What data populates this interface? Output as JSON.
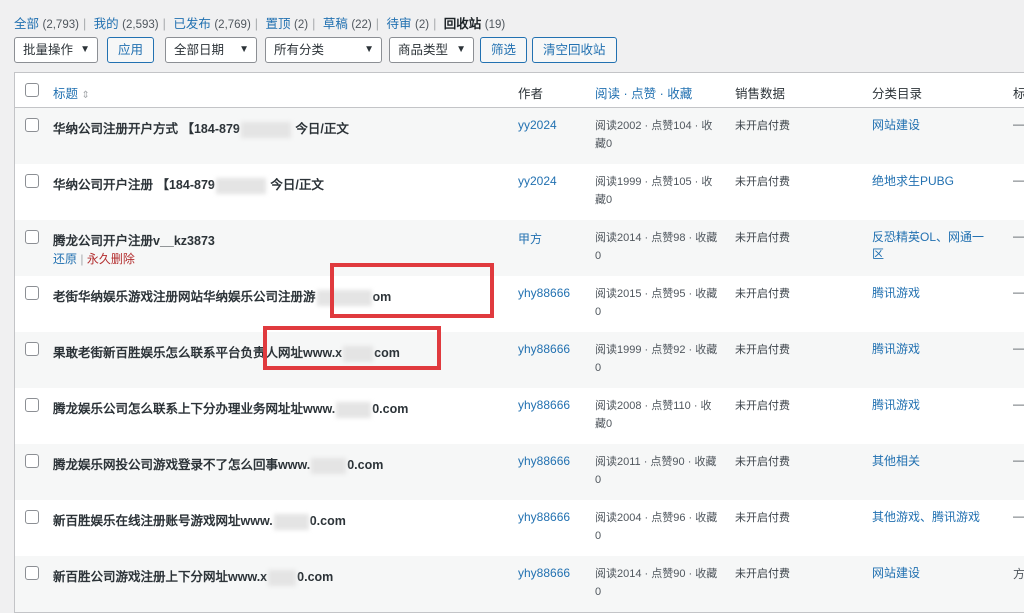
{
  "filters": [
    {
      "label": "全部",
      "count": "(2,793)",
      "current": false
    },
    {
      "label": "我的",
      "count": "(2,593)",
      "current": false
    },
    {
      "label": "已发布",
      "count": "(2,769)",
      "current": false
    },
    {
      "label": "置顶",
      "count": "(2)",
      "current": false
    },
    {
      "label": "草稿",
      "count": "(22)",
      "current": false
    },
    {
      "label": "待审",
      "count": "(2)",
      "current": false
    },
    {
      "label": "回收站",
      "count": "(19)",
      "current": true
    }
  ],
  "toolbar": {
    "bulk_actions": "批量操作",
    "apply": "应用",
    "all_dates": "全部日期",
    "all_categories": "所有分类",
    "product_type": "商品类型",
    "filter": "筛选",
    "empty_trash": "清空回收站"
  },
  "columns": {
    "title": "标题",
    "author": "作者",
    "views": "阅读 · 点赞 · 收藏",
    "sales": "销售数据",
    "categories": "分类目录",
    "extra": "标"
  },
  "row_actions": {
    "restore": "还原",
    "delete_permanently": "永久删除"
  },
  "rows": [
    {
      "title_pre": "华纳公司注册开户方式 【184-879",
      "title_post": "今日/正文",
      "author": "yy2024",
      "views": "阅读2002 · 点赞104 · 收藏0",
      "sales": "未开启付费",
      "categories": "网站建设",
      "extra": "—",
      "actions": false
    },
    {
      "title_pre": "华纳公司开户注册 【184-879",
      "title_post": "今日/正文",
      "author": "yy2024",
      "views": "阅读1999 · 点赞105 · 收藏0",
      "sales": "未开启付费",
      "categories": "绝地求生PUBG",
      "extra": "—",
      "actions": false
    },
    {
      "title_pre": "腾龙公司开户注册v__kz3873",
      "title_post": "",
      "author": "甲方",
      "views": "阅读2014 · 点赞98 · 收藏0",
      "sales": "未开启付费",
      "categories": "反恐精英OL、网通一区",
      "extra": "—",
      "actions": true
    },
    {
      "title_pre": "老街华纳娱乐游戏注册网站华纳娱乐公司注册游",
      "title_post": "om",
      "author": "yhy88666",
      "views": "阅读2015 · 点赞95 · 收藏0",
      "sales": "未开启付费",
      "categories": "腾讯游戏",
      "extra": "—",
      "actions": false
    },
    {
      "title_pre": "果敢老街新百胜娱乐怎么联系平台负责人网址www.x",
      "title_post": "com",
      "author": "yhy88666",
      "views": "阅读1999 · 点赞92 · 收藏0",
      "sales": "未开启付费",
      "categories": "腾讯游戏",
      "extra": "—",
      "actions": false
    },
    {
      "title_pre": "腾龙娱乐公司怎么联系上下分办理业务网址址www.",
      "title_post": "0.com",
      "author": "yhy88666",
      "views": "阅读2008 · 点赞110 · 收藏0",
      "sales": "未开启付费",
      "categories": "腾讯游戏",
      "extra": "—",
      "actions": false
    },
    {
      "title_pre": "腾龙娱乐网投公司游戏登录不了怎么回事www.",
      "title_post": "0.com",
      "author": "yhy88666",
      "views": "阅读2011 · 点赞90 · 收藏0",
      "sales": "未开启付费",
      "categories": "其他相关",
      "extra": "—",
      "actions": false
    },
    {
      "title_pre": "新百胜娱乐在线注册账号游戏网址www.",
      "title_post": "0.com",
      "author": "yhy88666",
      "views": "阅读2004 · 点赞96 · 收藏0",
      "sales": "未开启付费",
      "categories": "其他游戏、腾讯游戏",
      "extra": "—",
      "actions": false
    },
    {
      "title_pre": "新百胜公司游戏注册上下分网址www.x",
      "title_post": "0.com",
      "author": "yhy88666",
      "views": "阅读2014 · 点赞90 · 收藏0",
      "sales": "未开启付费",
      "categories": "网站建设",
      "extra": "方",
      "actions": false
    }
  ],
  "colors": {
    "link": "#2271b1",
    "danger": "#b32d2e",
    "highlight": "#e03a3e"
  }
}
